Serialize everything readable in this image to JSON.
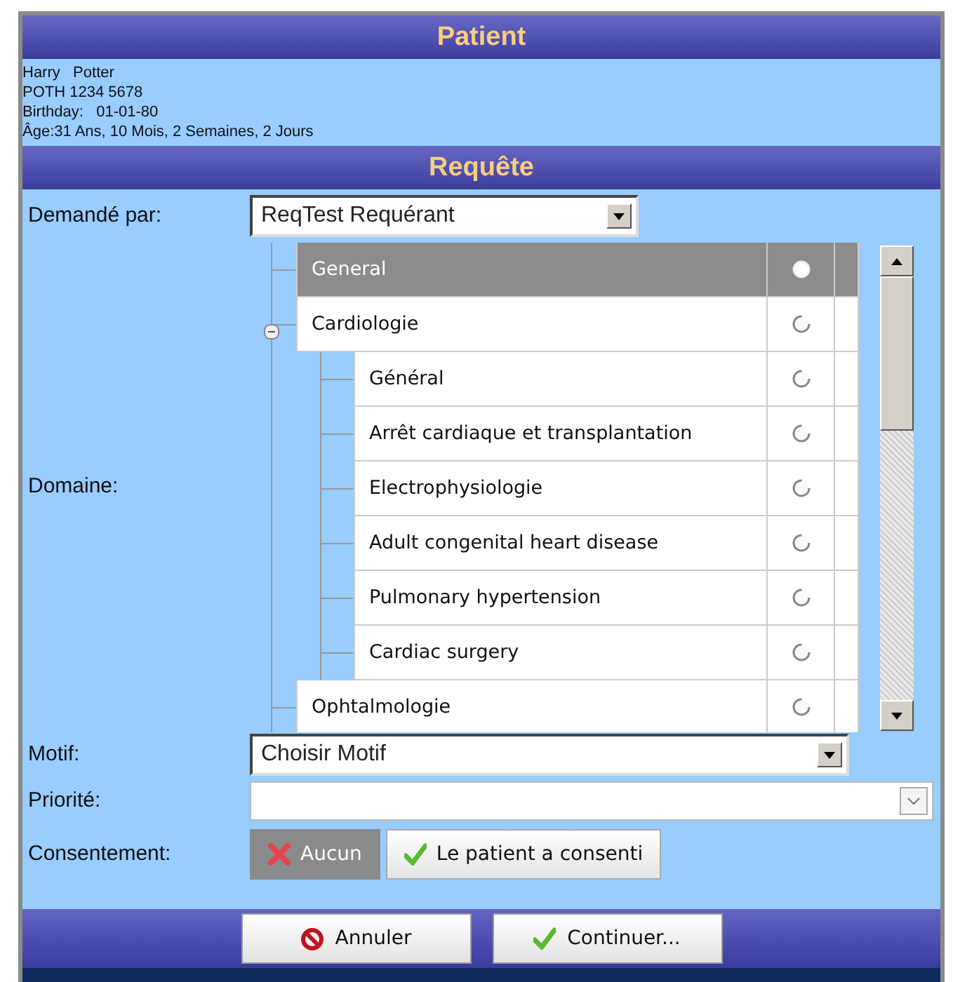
{
  "patient": {
    "title": "Patient",
    "lines": [
      "Harry   Potter",
      "POTH 1234 5678",
      "Birthday:   01-01-80",
      "Âge:31 Ans, 10 Mois, 2 Semaines, 2 Jours"
    ]
  },
  "request": {
    "title": "Requête",
    "requested_by": {
      "label": "Demandé par:",
      "value": "ReqTest Requérant"
    },
    "domain": {
      "label": "Domaine:",
      "tree": [
        {
          "label": "General",
          "selected": true,
          "checked": true
        },
        {
          "label": "Cardiologie",
          "selected": false,
          "checked": false,
          "expanded": true,
          "children": [
            {
              "label": "Général",
              "selected": false,
              "checked": false
            },
            {
              "label": "Arrêt cardiaque et transplantation",
              "selected": false,
              "checked": false
            },
            {
              "label": "Electrophysiologie",
              "selected": false,
              "checked": false
            },
            {
              "label": "Adult congenital heart disease",
              "selected": false,
              "checked": false
            },
            {
              "label": "Pulmonary hypertension",
              "selected": false,
              "checked": false
            },
            {
              "label": "Cardiac surgery",
              "selected": false,
              "checked": false
            }
          ]
        },
        {
          "label": "Ophtalmologie",
          "selected": false,
          "checked": false
        }
      ]
    },
    "motif": {
      "label": "Motif:",
      "value": "Choisir Motif"
    },
    "priority": {
      "label": "Priorité:"
    },
    "consent": {
      "label": "Consentement:",
      "options": [
        {
          "label": "Aucun",
          "kind": "none",
          "selected": true
        },
        {
          "label": "Le patient a consenti",
          "kind": "yes",
          "selected": false
        }
      ]
    }
  },
  "buttons": [
    {
      "label": "Annuler",
      "kind": "cancel"
    },
    {
      "label": "Continuer...",
      "kind": "ok"
    }
  ]
}
